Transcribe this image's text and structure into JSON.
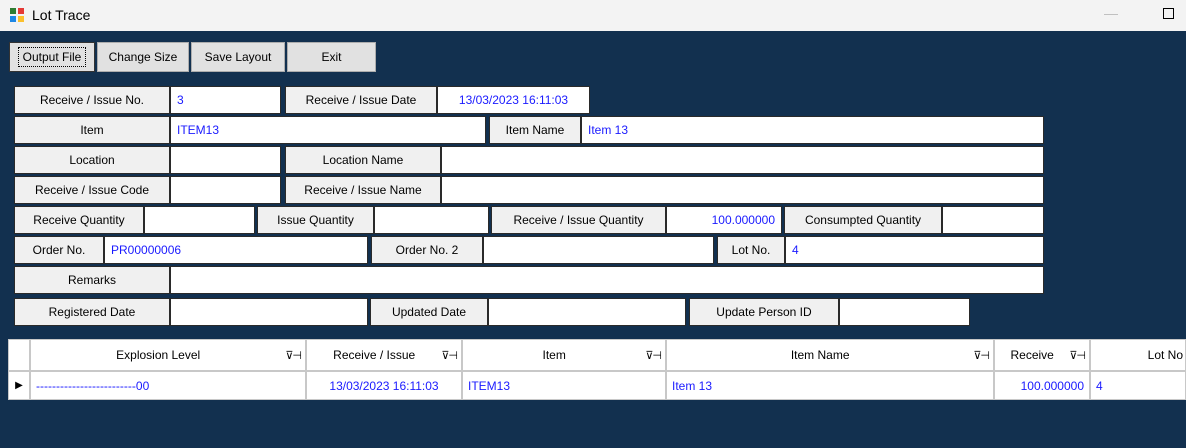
{
  "window": {
    "title": "Lot Trace"
  },
  "toolbar": {
    "output_file": "Output File",
    "change_size": "Change Size",
    "save_layout": "Save Layout",
    "exit": "Exit"
  },
  "form": {
    "receive_issue_no": {
      "label": "Receive / Issue No.",
      "value": "3"
    },
    "receive_issue_date": {
      "label": "Receive / Issue Date",
      "value": "13/03/2023 16:11:03"
    },
    "item": {
      "label": "Item",
      "value": "ITEM13"
    },
    "item_name": {
      "label": "Item Name",
      "value": "Item 13"
    },
    "location": {
      "label": "Location",
      "value": ""
    },
    "location_name": {
      "label": "Location Name",
      "value": ""
    },
    "receive_issue_code": {
      "label": "Receive / Issue Code",
      "value": ""
    },
    "receive_issue_name": {
      "label": "Receive / Issue Name",
      "value": ""
    },
    "receive_quantity": {
      "label": "Receive Quantity",
      "value": ""
    },
    "issue_quantity": {
      "label": "Issue Quantity",
      "value": ""
    },
    "receive_issue_quantity": {
      "label": "Receive / Issue Quantity",
      "value": "100.000000"
    },
    "consumpted_quantity": {
      "label": "Consumpted Quantity",
      "value": ""
    },
    "order_no": {
      "label": "Order No.",
      "value": "PR00000006"
    },
    "order_no_2": {
      "label": "Order No. 2",
      "value": ""
    },
    "lot_no": {
      "label": "Lot No.",
      "value": "4"
    },
    "remarks": {
      "label": "Remarks",
      "value": ""
    },
    "registered_date": {
      "label": "Registered Date",
      "value": ""
    },
    "updated_date": {
      "label": "Updated Date",
      "value": ""
    },
    "update_person_id": {
      "label": "Update Person ID",
      "value": ""
    }
  },
  "grid": {
    "columns": [
      "Explosion Level",
      "Receive / Issue",
      "Item",
      "Item Name",
      "Receive",
      "Lot No"
    ],
    "filter_icon": "⊽⊣",
    "rows": [
      {
        "selector": "▶",
        "explosion_level": "-------------------------00",
        "receive_issue": "13/03/2023 16:11:03",
        "item": "ITEM13",
        "item_name": "Item 13",
        "receive": "100.000000",
        "lot_no": "4"
      }
    ]
  }
}
